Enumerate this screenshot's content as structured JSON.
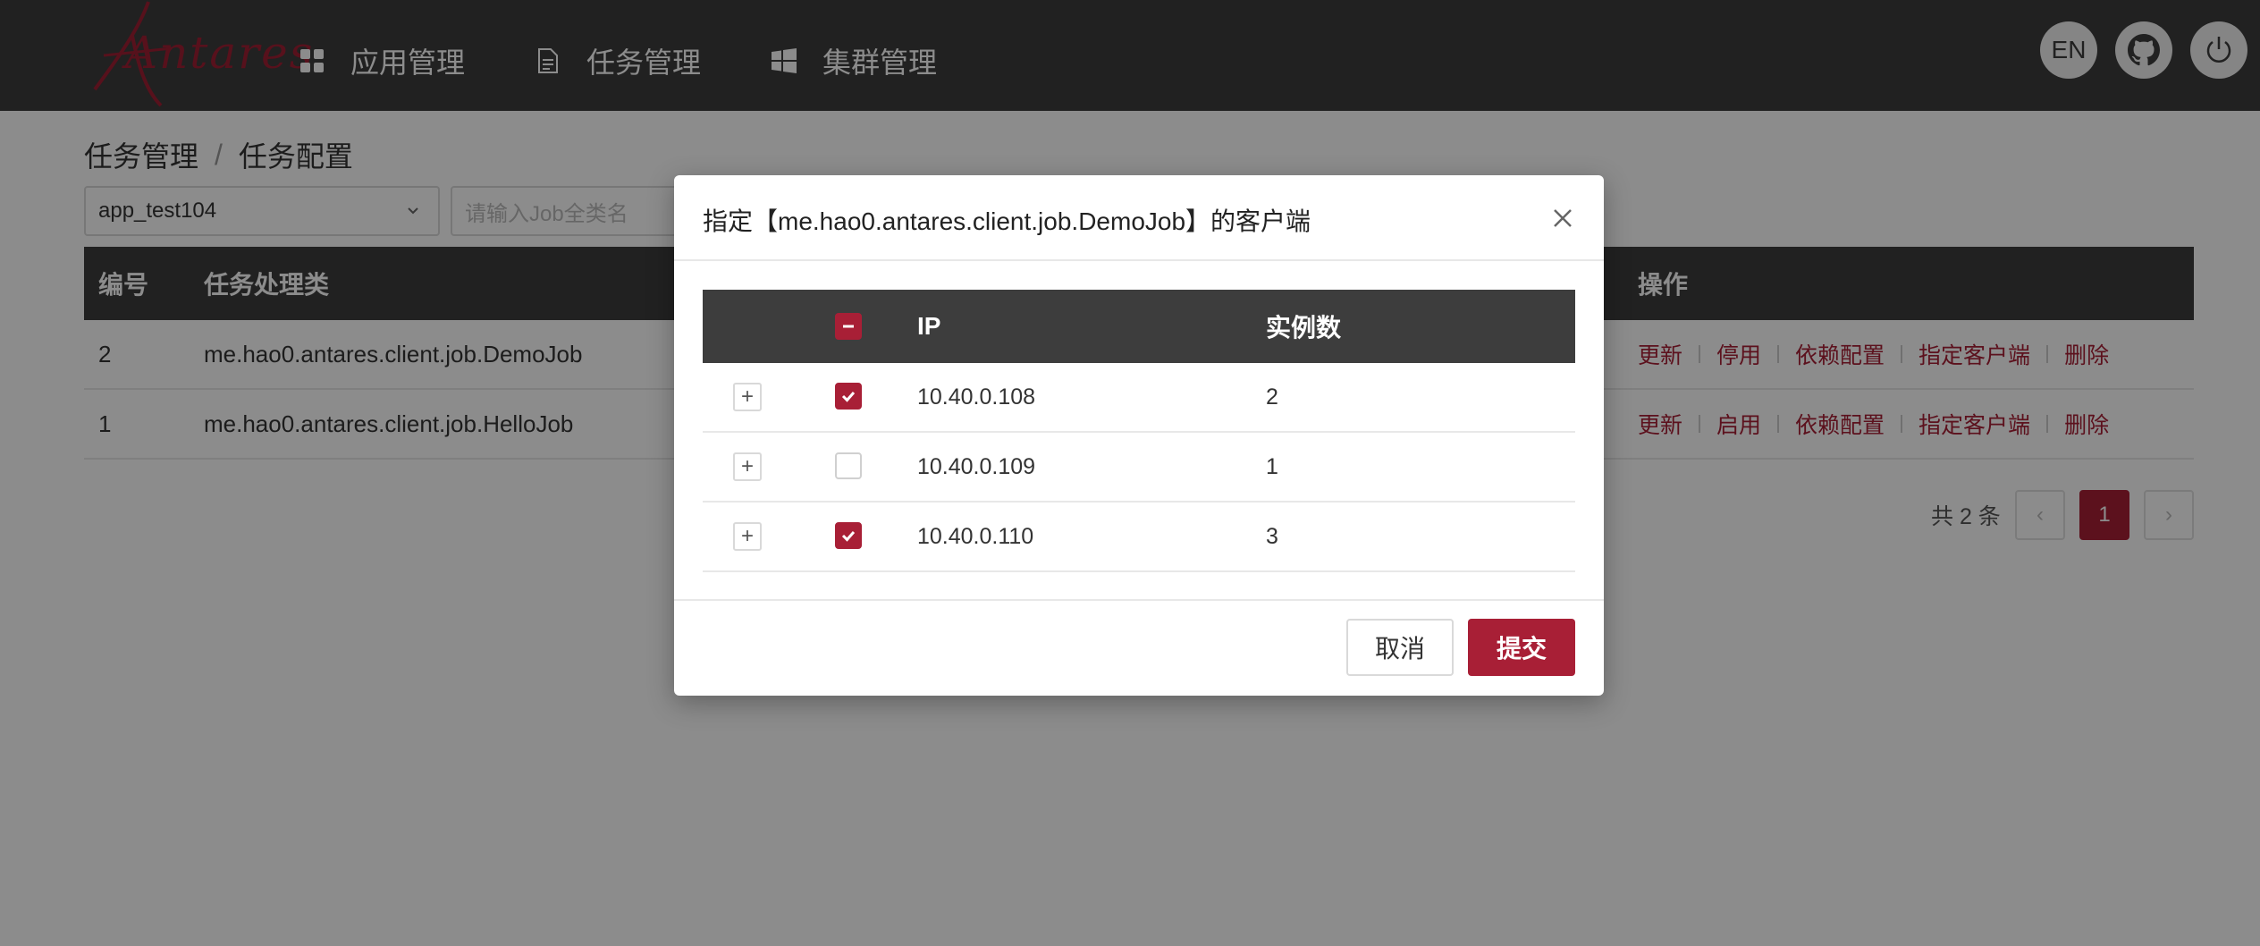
{
  "nav": {
    "logo_text": "Antares",
    "items": [
      {
        "label": "应用管理",
        "icon": "grid-icon"
      },
      {
        "label": "任务管理",
        "icon": "document-icon"
      },
      {
        "label": "集群管理",
        "icon": "windows-icon"
      }
    ],
    "lang_button": "EN",
    "github_icon": "github-icon",
    "power_icon": "power-icon"
  },
  "breadcrumb": {
    "parent": "任务管理",
    "separator": "/",
    "current": "任务配置"
  },
  "filters": {
    "app_select_value": "app_test104",
    "job_search_placeholder": "请输入Job全类名"
  },
  "table": {
    "headers": {
      "id": "编号",
      "class": "任务处理类",
      "ops": "操作"
    },
    "rows": [
      {
        "id": "2",
        "class": "me.hao0.antares.client.job.DemoJob",
        "ops": [
          "更新",
          "停用",
          "依赖配置",
          "指定客户端",
          "删除"
        ]
      },
      {
        "id": "1",
        "class": "me.hao0.antares.client.job.HelloJob",
        "ops": [
          "更新",
          "启用",
          "依赖配置",
          "指定客户端",
          "删除"
        ]
      }
    ]
  },
  "pagination": {
    "total_text": "共 2 条",
    "current_page": "1",
    "prev": "‹",
    "next": "›"
  },
  "modal": {
    "title": "指定【me.hao0.antares.client.job.DemoJob】的客户端",
    "headers": {
      "ip": "IP",
      "instances": "实例数"
    },
    "rows": [
      {
        "ip": "10.40.0.108",
        "instances": "2",
        "checked": true
      },
      {
        "ip": "10.40.0.109",
        "instances": "1",
        "checked": false
      },
      {
        "ip": "10.40.0.110",
        "instances": "3",
        "checked": true
      }
    ],
    "expand_symbol": "+",
    "cancel_label": "取消",
    "submit_label": "提交"
  },
  "colors": {
    "accent": "#a81f36",
    "nav_bg": "#3d3d3d"
  }
}
